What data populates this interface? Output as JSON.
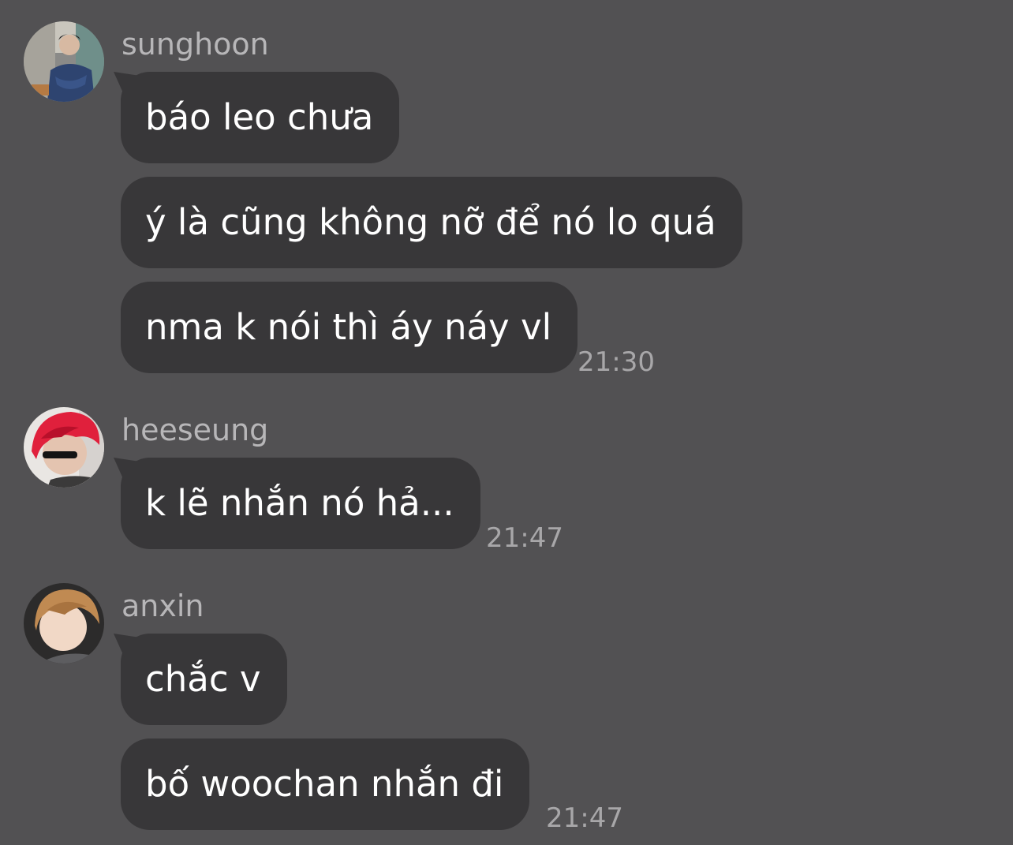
{
  "theme": {
    "background": "#525153",
    "bubble": "#383739",
    "sender_text": "#b7b6b8",
    "time_text": "#a8a7a9"
  },
  "groups": [
    {
      "sender": "sunghoon",
      "avatar_icon": "sunghoon-avatar",
      "messages": [
        "báo leo chưa",
        "ý là cũng không nỡ để nó lo quá",
        "nma k nói thì áy náy vl"
      ],
      "time": "21:30"
    },
    {
      "sender": "heeseung",
      "avatar_icon": "heeseung-avatar",
      "messages": [
        "k lẽ nhắn nó hả..."
      ],
      "time": "21:47"
    },
    {
      "sender": "anxin",
      "avatar_icon": "anxin-avatar",
      "messages": [
        "chắc v",
        "bố woochan nhắn đi"
      ],
      "time": "21:47"
    }
  ]
}
